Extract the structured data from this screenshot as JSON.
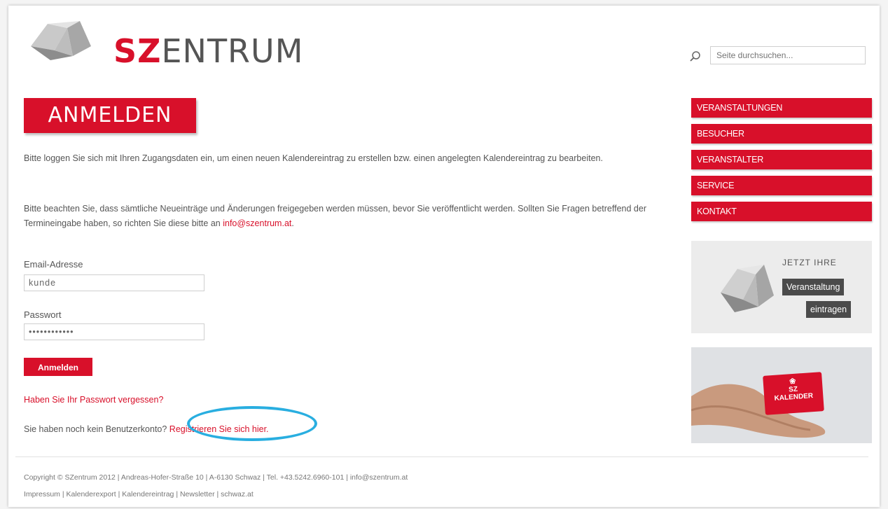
{
  "header": {
    "brand_bold": "SZ",
    "brand_rest": "ENTRUM",
    "search_placeholder": "Seite durchsuchen..."
  },
  "main": {
    "title": "ANMELDEN",
    "intro": "Bitte loggen Sie sich mit Ihren Zugangsdaten ein, um einen neuen Kalendereintrag zu erstellen bzw. einen angelegten Kalendereintrag zu bearbeiten.",
    "notice": "Bitte beachten Sie, dass sämtliche Neueinträge und Änderungen freigegeben werden müssen, bevor Sie veröffentlicht werden. Sollten Sie Fragen betreffend der Termineingabe haben, so richten Sie diese bitte an ",
    "notice_email": "info@szentrum.at",
    "notice_end": ".",
    "email_label": "Email-Adresse",
    "email_value": "kunde",
    "password_label": "Passwort",
    "password_value": "••••••••••••",
    "submit_label": "Anmelden",
    "forgot_link": "Haben Sie Ihr Passwort vergessen?",
    "register_text": "Sie haben noch kein Benutzerkonto? ",
    "register_link": "Registrieren Sie sich hier."
  },
  "sidebar": {
    "nav": [
      {
        "label": "VERANSTALTUNGEN"
      },
      {
        "label": "BESUCHER"
      },
      {
        "label": "VERANSTALTER"
      },
      {
        "label": "SERVICE"
      },
      {
        "label": "KONTAKT"
      }
    ],
    "promo1": {
      "heading": "JETZT IHRE",
      "tag1": "Veranstaltung",
      "tag2": "eintragen"
    },
    "promo2": {
      "card_line1": "SZ",
      "card_line2": "KALENDER"
    }
  },
  "footer": {
    "line1": "Copyright © SZentrum 2012 | Andreas-Hofer-Straße 10 | A-6130 Schwaz | Tel. +43.5242.6960-101 | info@szentrum.at",
    "line2": "Impressum | Kalenderexport | Kalendereintrag | Newsletter | schwaz.at"
  },
  "colors": {
    "brand_red": "#d8102a",
    "highlight_circle": "#29aee0"
  }
}
